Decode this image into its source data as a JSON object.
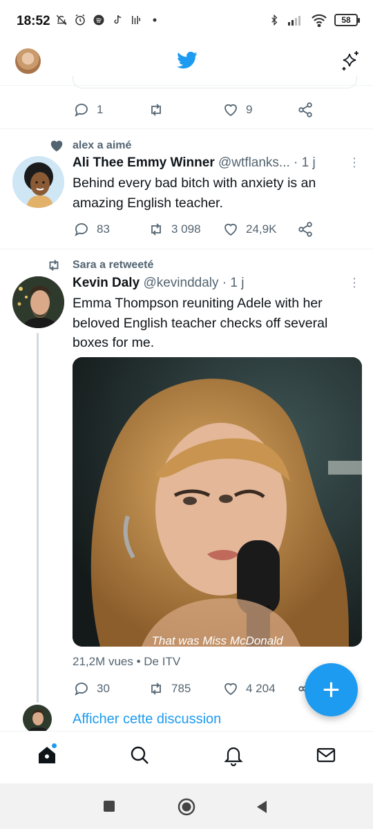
{
  "status_bar": {
    "time": "18:52",
    "battery": "58"
  },
  "header": {
    "logo": "twitter-bird-icon",
    "sparkle": "sparkle-icon"
  },
  "prev_tweet": {
    "replies": "1",
    "retweets": "",
    "likes": "9"
  },
  "tweet1": {
    "context": "alex a aimé",
    "name": "Ali Thee Emmy Winner",
    "handle": "@wtflanks...",
    "time": "· 1 j",
    "text": "Behind every bad bitch with anxiety is an amazing English teacher.",
    "replies": "83",
    "retweets": "3 098",
    "likes": "24,9K"
  },
  "tweet2": {
    "context": "Sara a retweeté",
    "name": "Kevin Daly",
    "handle": "@kevinddaly",
    "time": "· 1 j",
    "text": "Emma Thompson reuniting Adele with her beloved English teacher checks off several boxes for me.",
    "media_caption": "That was Miss McDonald",
    "views": "21,2M vues • De ITV",
    "replies": "30",
    "retweets": "785",
    "likes": "4 204"
  },
  "show_thread": "Afficher cette discussion",
  "fab": "+",
  "colors": {
    "accent": "#1d9bf0",
    "muted": "#536471"
  }
}
